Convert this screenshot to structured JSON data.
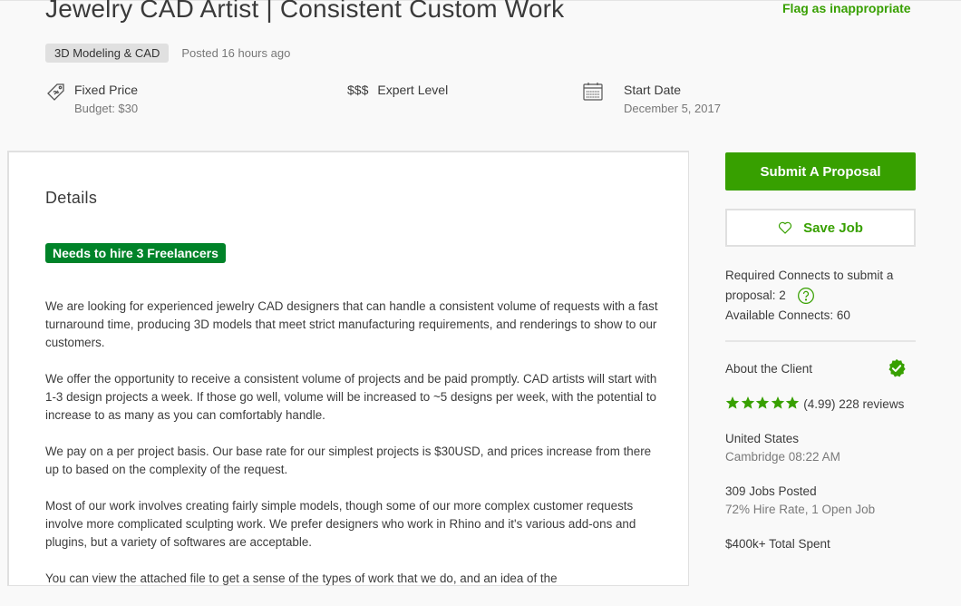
{
  "job": {
    "title": "Jewelry CAD Artist | Consistent Custom Work",
    "flag_link": "Flag as inappropriate",
    "category": "3D Modeling & CAD",
    "posted": "Posted 16 hours ago",
    "price_type": "Fixed Price",
    "budget": "Budget: $30",
    "level_sign": "$$$",
    "level": "Expert Level",
    "start_label": "Start Date",
    "start_date": "December 5, 2017"
  },
  "details": {
    "heading": "Details",
    "hire_badge": "Needs to hire 3 Freelancers",
    "paragraphs": [
      "We are looking for experienced jewelry CAD designers that can handle a consistent volume of requests with a fast turnaround time, producing 3D models that meet strict manufacturing requirements, and renderings to show to our customers.",
      "We offer the opportunity to receive a consistent volume of projects and be paid promptly.   CAD artists will start with 1-3 design projects a week.   If those go well, volume will be increased to ~5 designs per week, with the potential to increase to as many as you can comfortably handle.",
      "We pay on a per project basis. Our base rate for our simplest projects is $30USD, and prices increase from there up to based on the complexity of the request.",
      "Most of our work involves creating fairly simple models, though some of our more complex customer requests involve more complicated sculpting work. We prefer designers who work in Rhino and it's various add-ons and plugins, but a variety of softwares are acceptable.",
      "You can view the attached file to get a sense of the types of work that we do, and an idea of the"
    ]
  },
  "sidebar": {
    "submit_label": "Submit A Proposal",
    "save_label": "Save Job",
    "connects_required": "Required Connects to submit a proposal: 2",
    "connects_available": "Available Connects: 60",
    "about_title": "About the Client",
    "rating_text": "(4.99) 228 reviews",
    "rating_value": 4.99,
    "rating_max": 5,
    "country": "United States",
    "city_time": "Cambridge 08:22 AM",
    "jobs_posted": "309 Jobs Posted",
    "hire_rate": "72% Hire Rate, 1 Open Job",
    "total_spent": "$400k+ Total Spent"
  },
  "colors": {
    "accent": "#37a000",
    "badge": "#008329",
    "text": "#3c3c3c",
    "muted": "#777777"
  }
}
